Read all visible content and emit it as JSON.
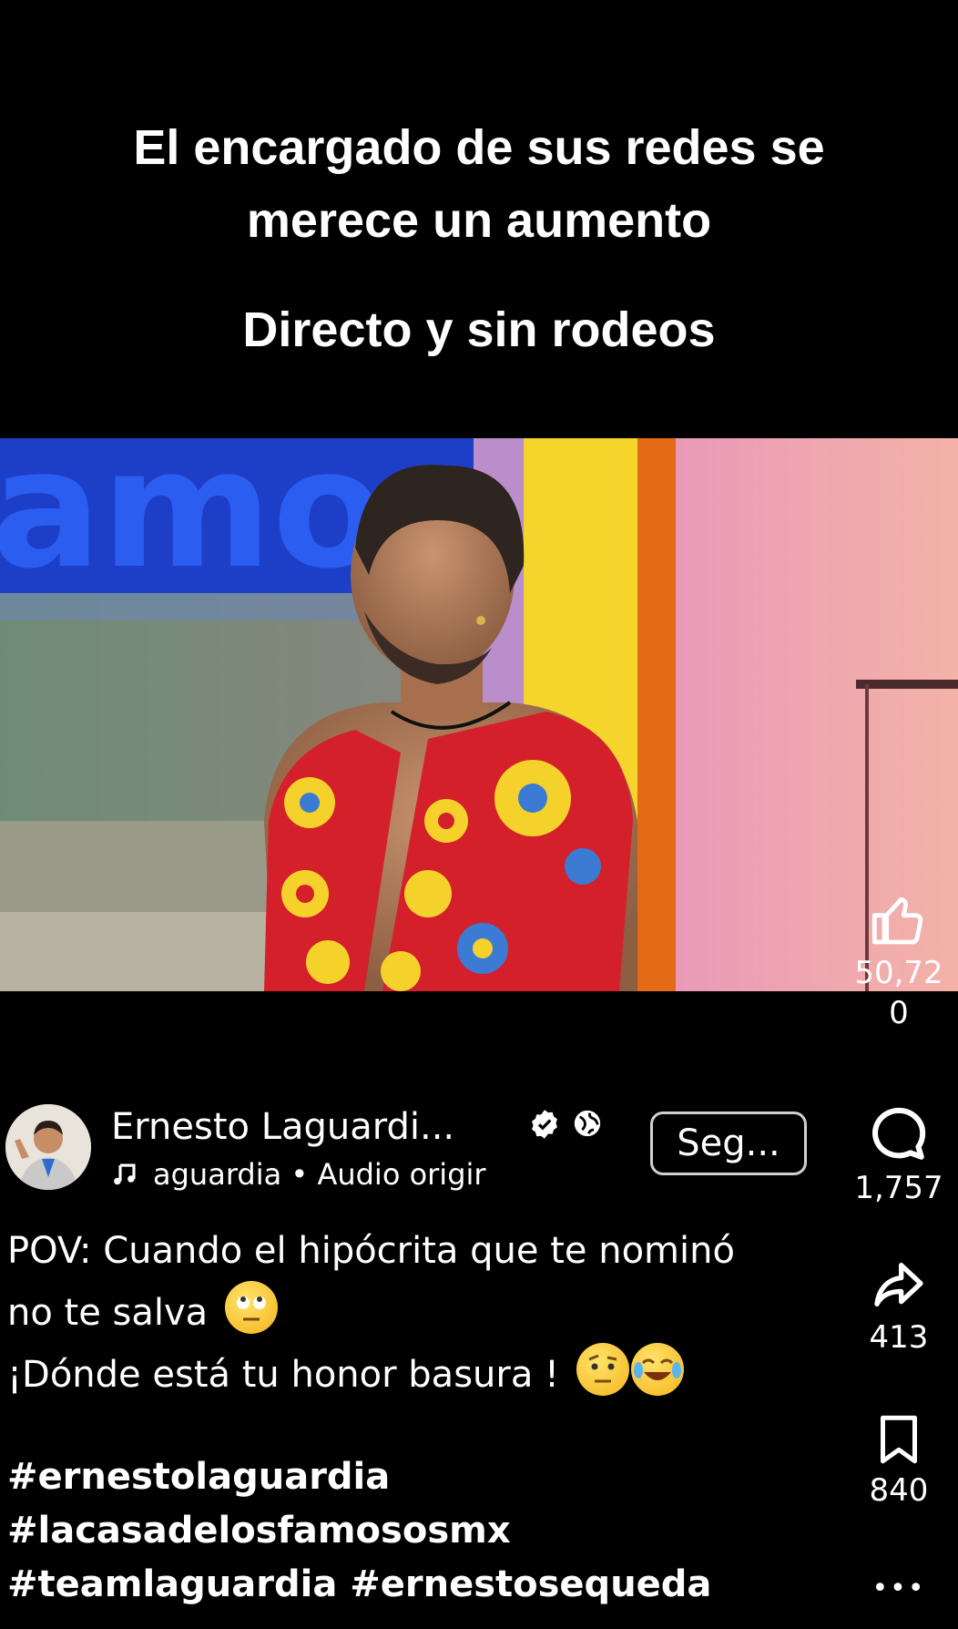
{
  "overlay": {
    "headline": "El encargado de sus redes se merece un aumento",
    "subheadline": "Directo y sin rodeos"
  },
  "video": {
    "studio_sign_text": "amos"
  },
  "rail": {
    "like_count": "50,72 0",
    "comment_count": "1,757",
    "share_count": "413",
    "save_count": "840",
    "more_label": "•••"
  },
  "author": {
    "name": "Ernesto Laguardi...",
    "audio": "aguardia • Audio origir",
    "follow_label": "Seg..."
  },
  "caption": {
    "line1": "POV: Cuando el hipócrita que te nominó",
    "line2": "no te salva",
    "line3": "¡Dónde está tu honor basura !"
  },
  "hashtags": [
    "#ernestolaguardia",
    "#lacasadelosfamososmx",
    "#teamlaguardia #ernestosequeda"
  ],
  "icons": {
    "like": "thumbs-up-icon",
    "comment": "comment-icon",
    "share": "share-icon",
    "save": "bookmark-icon",
    "verified": "verified-icon",
    "globe": "globe-icon",
    "music": "music-note-icon"
  }
}
